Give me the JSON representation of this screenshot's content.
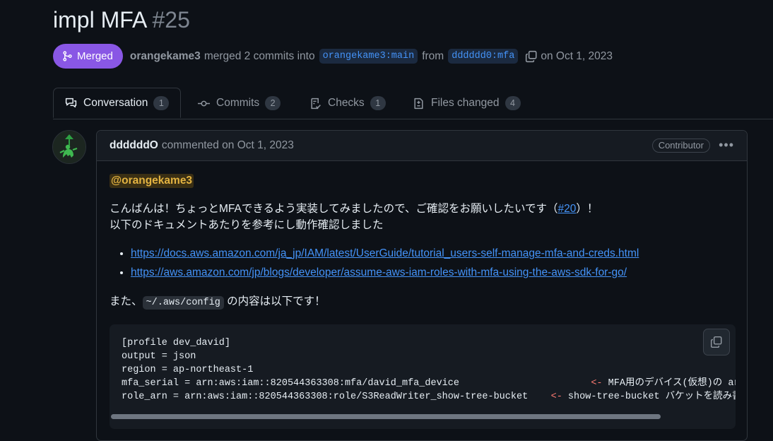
{
  "pr": {
    "title": "impl MFA",
    "number": "#25",
    "state": "Merged",
    "author": "orangekame3",
    "merged_text": "merged 2 commits into",
    "base_branch": "orangekame3:main",
    "from_text": "from",
    "head_branch": "dddddd0:mfa",
    "date_text": "on Oct 1, 2023"
  },
  "tabs": [
    {
      "label": "Conversation",
      "count": "1"
    },
    {
      "label": "Commits",
      "count": "2"
    },
    {
      "label": "Checks",
      "count": "1"
    },
    {
      "label": "Files changed",
      "count": "4"
    }
  ],
  "comment": {
    "author": "ddddddO",
    "action": "commented on Oct 1, 2023",
    "role": "Contributor",
    "mention": "@orangekame3",
    "line1_a": "こんばんは！ちょっとMFAできるよう実装してみましたので、ご確認をお願いしたいです（",
    "issue_link": "#20",
    "line1_b": "）！",
    "line2": "以下のドキュメントあたりを参考にし動作確認しました",
    "links": [
      "https://docs.aws.amazon.com/ja_jp/IAM/latest/UserGuide/tutorial_users-self-manage-mfa-and-creds.html",
      "https://aws.amazon.com/jp/blogs/developer/assume-aws-iam-roles-with-mfa-using-the-aws-sdk-for-go/"
    ],
    "line3_a": "また、",
    "config_path": "~/.aws/config",
    "line3_b": "の内容は以下です！",
    "code_lines": [
      "[profile dev_david]",
      "output = json",
      "region = ap-northeast-1",
      "mfa_serial = arn:aws:iam::820544363308:mfa/david_mfa_device",
      "role_arn = arn:aws:iam::820544363308:role/S3ReadWriter_show-tree-bucket"
    ],
    "code_note_1_arrow": "<-",
    "code_note_1": "MFA用のデバイス(仮想)の arn",
    "code_note_2_arrow": "<-",
    "code_note_2": "show-tree-bucket バケットを読み書きで"
  },
  "colors": {
    "merged": "#8957e5",
    "link": "#4493f8",
    "background": "#0d1117"
  }
}
